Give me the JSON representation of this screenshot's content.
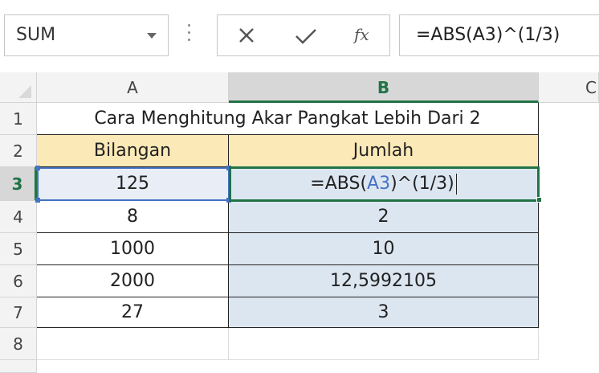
{
  "formula_bar": {
    "name_box": "SUM",
    "fx_label": "fx",
    "formula": "=ABS(A3)^(1/3)"
  },
  "columns": [
    "A",
    "B",
    "C"
  ],
  "rows": [
    "1",
    "2",
    "3",
    "4",
    "5",
    "6",
    "7",
    "8"
  ],
  "sheet": {
    "title": "Cara Menghitung Akar Pangkat Lebih Dari 2",
    "header_bilangan": "Bilangan",
    "header_jumlah": "Jumlah",
    "edit_prefix": "=ABS(",
    "edit_ref": "A3",
    "edit_suffix": ")^(1/3)",
    "data": [
      {
        "a": "125",
        "b": ""
      },
      {
        "a": "8",
        "b": "2"
      },
      {
        "a": "1000",
        "b": "10"
      },
      {
        "a": "2000",
        "b": "12,5992105"
      },
      {
        "a": "27",
        "b": "3"
      }
    ]
  },
  "colors": {
    "accent": "#217346",
    "reference": "#4472c4",
    "header_fill": "#fbe9b7",
    "result_fill": "#dce6f1"
  },
  "icons": {
    "cancel": "x-icon",
    "enter": "check-icon",
    "function": "fx-icon"
  }
}
